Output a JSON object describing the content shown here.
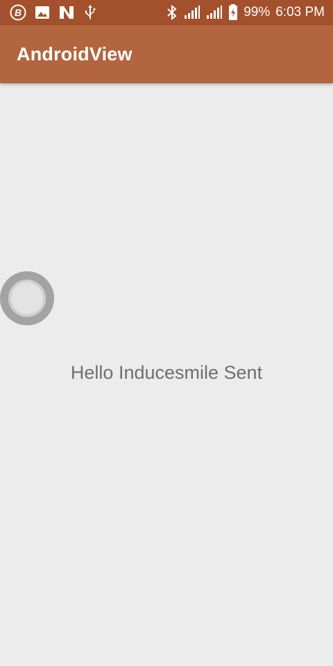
{
  "status_bar": {
    "left_icons": [
      "b-circle-icon",
      "image-icon",
      "n-logo-icon",
      "usb-icon"
    ],
    "right_icons": [
      "bluetooth-icon",
      "signal-icon",
      "signal-icon-2",
      "battery-charging-icon"
    ],
    "battery_label": "99%",
    "time_label": "6:03 PM",
    "color": "#a2512c"
  },
  "app_bar": {
    "title": "AndroidView",
    "color": "#b2653e"
  },
  "main": {
    "message": "Hello Inducesmile Sent",
    "background": "#ececec"
  }
}
